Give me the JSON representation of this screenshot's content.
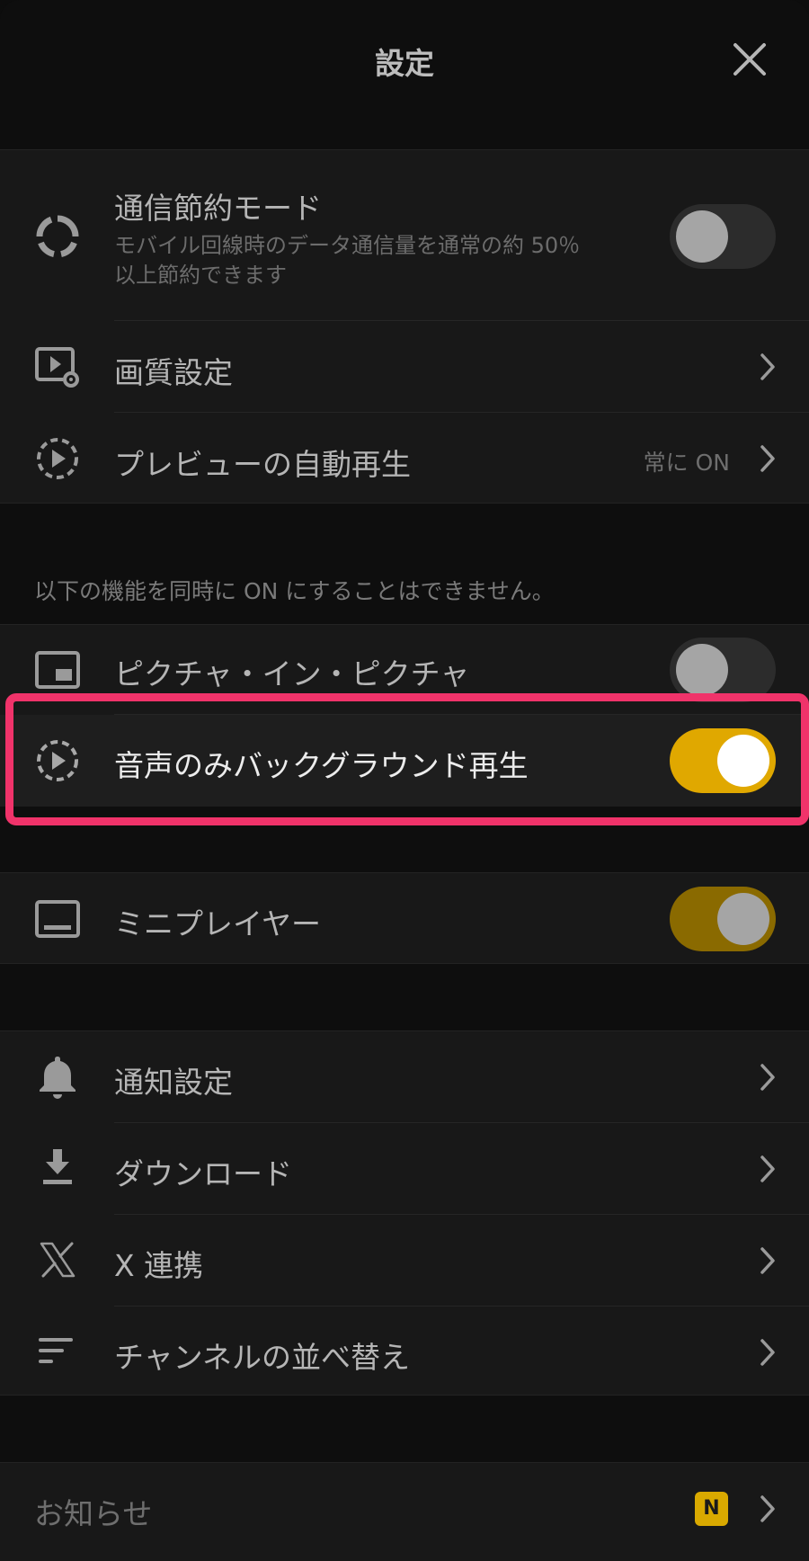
{
  "header": {
    "title": "設定"
  },
  "groups": {
    "network": {
      "data_saver": {
        "label": "通信節約モード",
        "description_line1": "モバイル回線時のデータ通信量を通常の約 50％",
        "description_line2": "以上節約できます",
        "enabled": false
      },
      "quality": {
        "label": "画質設定"
      },
      "preview_autoplay": {
        "label": "プレビューの自動再生",
        "value": "常に ON"
      }
    },
    "exclusive_note": "以下の機能を同時に ON にすることはできません。",
    "exclusive": {
      "pip": {
        "label": "ピクチャ・イン・ピクチャ",
        "enabled": false
      },
      "audio_background": {
        "label": "音声のみバックグラウンド再生",
        "enabled": true
      }
    },
    "player": {
      "mini_player": {
        "label": "ミニプレイヤー",
        "enabled": true
      }
    },
    "general": {
      "notifications": {
        "label": "通知設定"
      },
      "downloads": {
        "label": "ダウンロード"
      },
      "x_link": {
        "label": "X 連携"
      },
      "channel_order": {
        "label": "チャンネルの並べ替え"
      }
    },
    "news": {
      "label": "お知らせ",
      "badge": "N"
    }
  },
  "colors": {
    "accent_on": "#e0a800",
    "accent_dim": "#8a6a00",
    "highlight": "#f0336a",
    "toggle_off": "#2c2c2c"
  },
  "icons": {
    "close": "close-icon",
    "data_saver": "data-saver-ring-icon",
    "quality": "video-settings-icon",
    "preview": "dashed-play-icon",
    "pip": "picture-in-picture-icon",
    "audio": "dashed-play-icon",
    "mini_player": "mini-player-icon",
    "notifications": "bell-icon",
    "downloads": "download-icon",
    "x_link": "x-logo-icon",
    "channel_order": "sort-lines-icon",
    "chevron": "chevron-right-icon"
  }
}
